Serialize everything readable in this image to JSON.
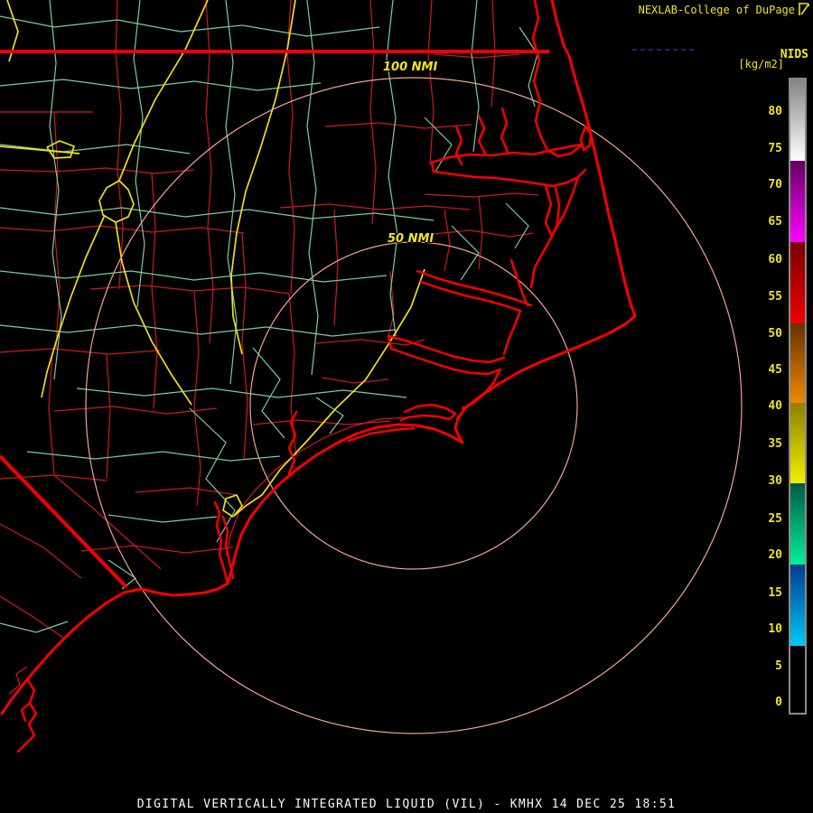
{
  "header": {
    "brand": "NEXLAB-College of DuPage",
    "logo_icon": "college-of-dupage-flag-icon"
  },
  "scale": {
    "title": "NIDS",
    "units": "[kg/m2]",
    "tick_labels": [
      "80",
      "75",
      "70",
      "65",
      "60",
      "55",
      "50",
      "45",
      "40",
      "35",
      "30",
      "25",
      "20",
      "15",
      "10",
      "5",
      "0"
    ],
    "segments": [
      {
        "name": "gray",
        "from": 73,
        "to": 85,
        "color_top": "#848484",
        "color_bottom": "#ffffff"
      },
      {
        "name": "purple",
        "from": 62,
        "to": 73,
        "color_top": "#640064",
        "color_bottom": "#ff00ff"
      },
      {
        "name": "red",
        "from": 51,
        "to": 62,
        "color_top": "#780000",
        "color_bottom": "#f00000"
      },
      {
        "name": "orange",
        "from": 41,
        "to": 51,
        "color_top": "#643200",
        "color_bottom": "#f08800"
      },
      {
        "name": "yellow",
        "from": 30,
        "to": 41,
        "color_top": "#907e00",
        "color_bottom": "#f0f000"
      },
      {
        "name": "teal",
        "from": 19,
        "to": 30,
        "color_top": "#005a48",
        "color_bottom": "#00f096"
      },
      {
        "name": "blue",
        "from": 8,
        "to": 19,
        "color_top": "#003c8c",
        "color_bottom": "#00c8f5"
      },
      {
        "name": "black",
        "from": 0,
        "to": 8,
        "color_top": "#000000",
        "color_bottom": "#000000"
      }
    ]
  },
  "map": {
    "radar_site": "KMHX",
    "rings": [
      {
        "label": "100 NMI"
      },
      {
        "label": "50 NMI"
      }
    ],
    "colors": {
      "background": "#000000",
      "coastline": "#f80000",
      "state_border": "#f20000",
      "county_boundary": "#ce1a1a",
      "road": "#7bcd9d",
      "highway": "#efe019",
      "range_ring": "#f2a48e",
      "label_yellow": "#f2e41c",
      "footer_text": "#fafafa"
    }
  },
  "footer": {
    "title": "DIGITAL VERTICALLY INTEGRATED LIQUID (VIL) - KMHX 14 DEC 25 18:51"
  }
}
